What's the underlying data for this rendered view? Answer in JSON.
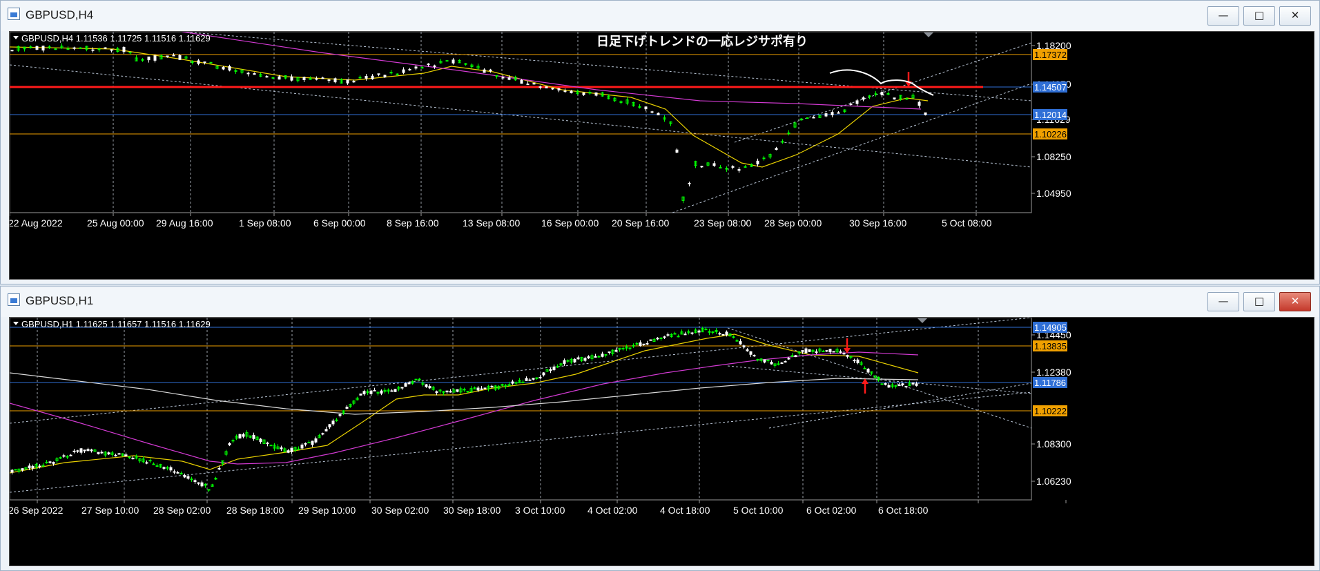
{
  "colors": {
    "background": "#000000",
    "candle_up": "#00ff00",
    "candle_down": "#ffffff",
    "ma_yellow": "#e8d000",
    "ma_magenta": "#d23ad2",
    "ma_white": "#d8d8d8",
    "level_orange": "#f0a000",
    "level_blue": "#2f6fd6",
    "level_red": "#ff1a1a",
    "grid": "#9aa0a8",
    "trendline": "#b8c4d4"
  },
  "windows": [
    {
      "title": "GBPUSD,H4",
      "header": "GBPUSD,H4  1.11536 1.11725 1.11516 1.11629",
      "annotation": "日足下げトレンドの一応レジサポ有り",
      "buttons": {
        "minimize": "minimize",
        "maximize": "maximize",
        "close": "close"
      },
      "price_ticks": [
        "1.18200",
        "1.14950",
        "1.11629",
        "1.08250",
        "1.04950"
      ],
      "levels": [
        {
          "label": "1.17372",
          "kind": "orange"
        },
        {
          "label": "1.14507",
          "kind": "blue"
        },
        {
          "label": "1.12014",
          "kind": "blue"
        },
        {
          "label": "1.10226",
          "kind": "orange"
        }
      ],
      "time_ticks": [
        "22 Aug 2022",
        "25 Aug 00:00",
        "29 Aug 16:00",
        "1 Sep 08:00",
        "6 Sep 00:00",
        "8 Sep 16:00",
        "13 Sep 08:00",
        "16 Sep 00:00",
        "20 Sep 16:00",
        "23 Sep 08:00",
        "28 Sep 00:00",
        "30 Sep 16:00",
        "5 Oct 08:00"
      ]
    },
    {
      "title": "GBPUSD,H1",
      "header": "GBPUSD,H1  1.11625 1.11657 1.11516 1.11629",
      "buttons": {
        "minimize": "minimize",
        "maximize": "maximize",
        "close": "close"
      },
      "price_ticks": [
        "1.14450",
        "1.12380",
        "1.08300",
        "1.06230"
      ],
      "levels": [
        {
          "label": "1.14905",
          "kind": "blue"
        },
        {
          "label": "1.13835",
          "kind": "orange"
        },
        {
          "label": "1.11786",
          "kind": "blue"
        },
        {
          "label": "1.10222",
          "kind": "orange"
        }
      ],
      "time_ticks": [
        "26 Sep 2022",
        "27 Sep 10:00",
        "28 Sep 02:00",
        "28 Sep 18:00",
        "29 Sep 10:00",
        "30 Sep 02:00",
        "30 Sep 18:00",
        "3 Oct 10:00",
        "4 Oct 02:00",
        "4 Oct 18:00",
        "5 Oct 10:00",
        "6 Oct 02:00",
        "6 Oct 18:00"
      ]
    }
  ]
}
